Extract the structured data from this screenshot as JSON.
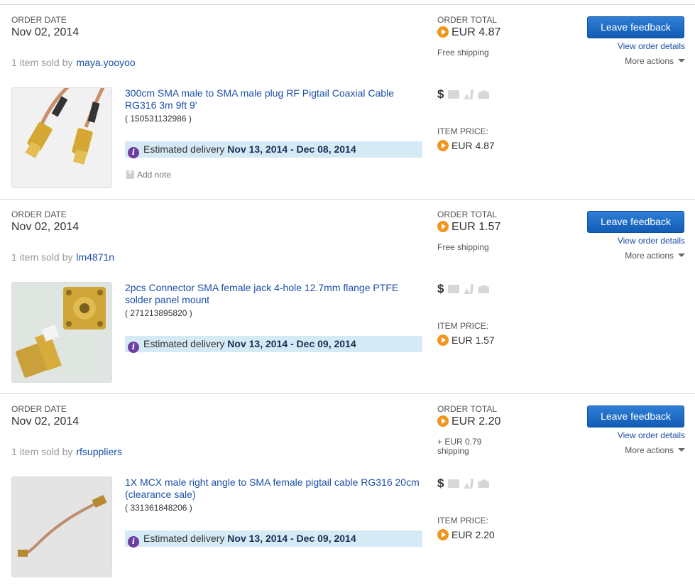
{
  "labels": {
    "order_date": "ORDER DATE",
    "order_total": "ORDER TOTAL",
    "item_price": "ITEM PRICE:",
    "leave_feedback": "Leave feedback",
    "view_order_details": "View order details",
    "more_actions": "More actions",
    "add_note": "Add note",
    "estimated_delivery": "Estimated delivery",
    "sold_prefix": "1 item sold by"
  },
  "orders": [
    {
      "date": "Nov 02, 2014",
      "seller": "maya.yooyoo",
      "total": "EUR 4.87",
      "shipping": "Free shipping",
      "title": "300cm SMA male to SMA male plug RF Pigtail Coaxial Cable RG316 3m 9ft 9'",
      "item_number": "( 150531132986 )",
      "delivery_range": "Nov 13, 2014 - Dec 08, 2014",
      "item_price": "EUR 4.87",
      "has_add_note": true
    },
    {
      "date": "Nov 02, 2014",
      "seller": "lm4871n",
      "total": "EUR 1.57",
      "shipping": "Free shipping",
      "title": "2pcs Connector SMA female jack 4-hole 12.7mm flange PTFE solder panel mount",
      "item_number": "( 271213895820 )",
      "delivery_range": "Nov 13, 2014 - Dec 09, 2014",
      "item_price": "EUR 1.57",
      "has_add_note": false
    },
    {
      "date": "Nov 02, 2014",
      "seller": "rfsuppliers",
      "total": "EUR 2.20",
      "shipping": "+ EUR 0.79 shipping",
      "title": "1X MCX male right angle to SMA female pigtail cable RG316 20cm (clearance sale)",
      "item_number": "( 331361848206 )",
      "delivery_range": "Nov 13, 2014 - Dec 09, 2014",
      "item_price": "EUR 2.20",
      "has_add_note": false
    }
  ],
  "colors": {
    "link": "#1c4fa8",
    "button": "#1b6ac6",
    "delivery_bg": "#d6eaf6",
    "coin": "#f0961e",
    "info_icon": "#6d3fa3"
  },
  "icons": [
    "dollar-icon",
    "payment-icon",
    "shipping-icon",
    "feedback-icon",
    "info-icon",
    "coin-icon",
    "note-icon",
    "chevron-down-icon"
  ]
}
